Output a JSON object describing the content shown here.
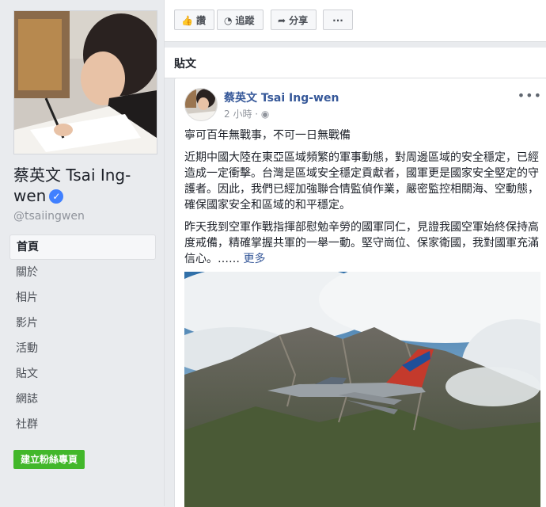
{
  "page": {
    "name": "蔡英文 Tsai Ing-wen",
    "handle": "@tsaiingwen",
    "nav": [
      "首頁",
      "關於",
      "相片",
      "影片",
      "活動",
      "貼文",
      "網誌",
      "社群"
    ],
    "create_page_button": "建立粉絲專頁"
  },
  "toolbar": {
    "like": "讚",
    "follow": "追蹤",
    "share": "分享",
    "more": "···"
  },
  "posts_section_title": "貼文",
  "post": {
    "author": "蔡英文 Tsai Ing-wen",
    "time": "2 小時",
    "headline": "寧可百年無戰事，不可一日無戰備",
    "paragraph1": "近期中國大陸在東亞區域頻繁的軍事動態，對周邊區域的安全穩定，已經造成一定衝擊。台灣是區域安全穩定貢獻者，國軍更是國家安全堅定的守護者。因此，我們已經加強聯合情監偵作業，嚴密監控相關海、空動態，確保國家安全和區域的和平穩定。",
    "paragraph2": "昨天我到空軍作戰指揮部慰勉辛勞的國軍同仁，見證我國空軍始終保持高度戒備，精確掌握共軍的一舉一動。堅守崗位、保家衛國，我對國軍充滿信心。……",
    "see_more": "更多"
  },
  "colors": {
    "link": "#365899",
    "verified": "#4080ff",
    "create_button": "#42b72a"
  }
}
